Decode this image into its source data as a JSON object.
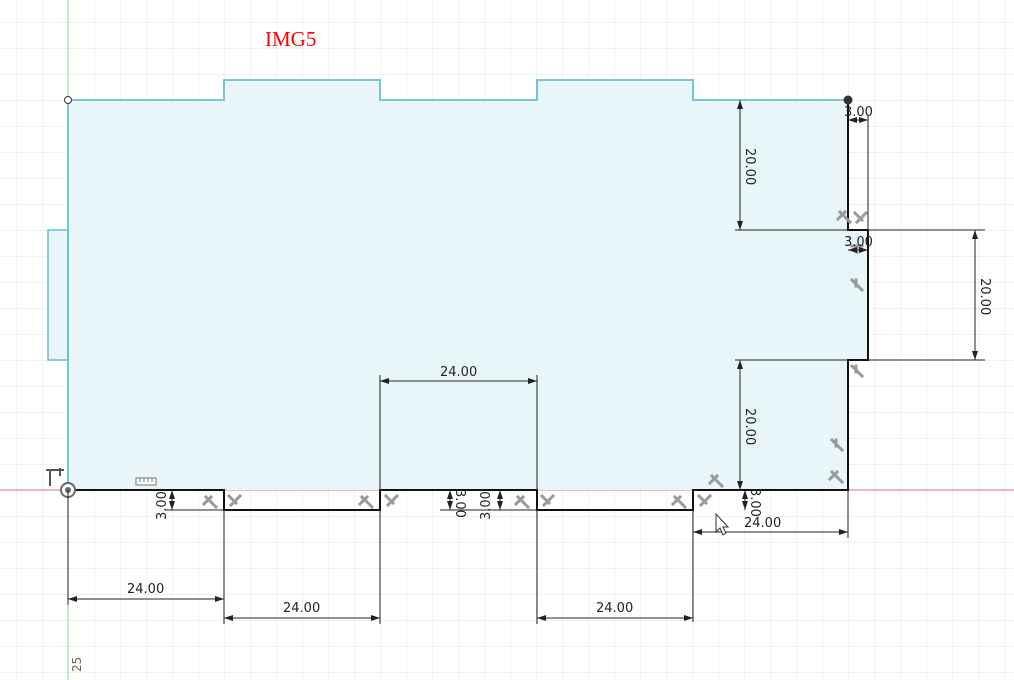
{
  "caption": "IMG5",
  "axis_label": "25",
  "colors": {
    "grid": "#e3e6e8",
    "profile_fill": "#e8f6fa",
    "profile_stroke": "#66bfd1",
    "line": "#111111",
    "dimension": "#222222",
    "axis_x": "#e07575",
    "axis_y": "#90d590",
    "caption": "#ff0000"
  },
  "dimensions": {
    "right_top_width": "3.00",
    "right_top_height": "20.00",
    "right_notch_width": "3.00",
    "right_notch_height": "20.00",
    "right_bottom_height": "20.00",
    "middle_tab_width": "24.00",
    "tab1_depth": "3.00",
    "tab2_depth_left": "3.00",
    "tab2_depth_right": "3.00",
    "tab3_depth": "3.00",
    "tab3_width": "24.00",
    "left_segment_width": "24.00",
    "tab1_width": "24.00",
    "tab3_bottom_width": "24.00"
  },
  "icons": {
    "constraint": "horizontal-vertical-constraint-icon",
    "origin": "origin-point-icon",
    "cursor": "mouse-pointer-icon"
  }
}
